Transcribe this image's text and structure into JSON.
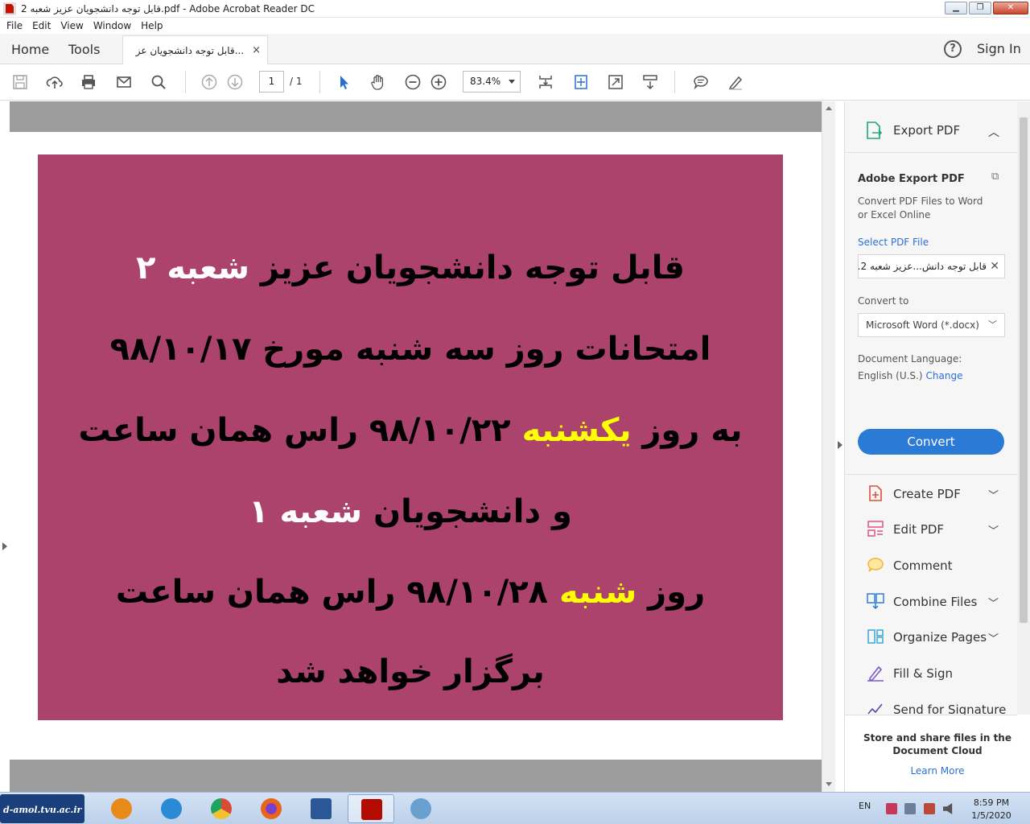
{
  "window": {
    "title": "قابل توجه دانشجویان عزیز شعبه 2.pdf - Adobe Acrobat Reader DC",
    "controls": {
      "minimize": "▁",
      "restore": "❐",
      "close": "✕"
    }
  },
  "menu": [
    "File",
    "Edit",
    "View",
    "Window",
    "Help"
  ],
  "nav": {
    "home": "Home",
    "tools": "Tools",
    "sign_in": "Sign In",
    "help": "?"
  },
  "tab": {
    "label": "قابل توجه دانشجویان عز...",
    "close": "×"
  },
  "toolbar": {
    "page_current": "1",
    "page_total": "/ 1",
    "zoom": "83.4%"
  },
  "document": {
    "background": "#ab436c",
    "lines": [
      [
        {
          "t": "قابل توجه دانشجویان عزیز ",
          "c": "black"
        },
        {
          "t": "شعبه ۲",
          "c": "white"
        }
      ],
      [
        {
          "t": "امتحانات روز سه شنبه مورخ ۹۸/۱۰/۱۷",
          "c": "black"
        }
      ],
      [
        {
          "t": "به روز ",
          "c": "black"
        },
        {
          "t": "یکشنبه",
          "c": "yellow"
        },
        {
          "t": " ۹۸/۱۰/۲۲ راس همان ساعت",
          "c": "black"
        }
      ],
      [
        {
          "t": "و دانشجویان ",
          "c": "black"
        },
        {
          "t": "شعبه ۱",
          "c": "white"
        }
      ],
      [
        {
          "t": "روز ",
          "c": "black"
        },
        {
          "t": "شنبه",
          "c": "yellow"
        },
        {
          "t": " ۹۸/۱۰/۲۸ راس همان ساعت",
          "c": "black"
        }
      ],
      [
        {
          "t": "برگزار خواهد شد",
          "c": "black"
        }
      ]
    ]
  },
  "right_pane": {
    "export_header": "Export PDF",
    "export_title": "Adobe Export PDF",
    "export_desc": "Convert PDF Files to Word or Excel Online",
    "select_link": "Select PDF File",
    "file_name": "قابل توجه دانش...عزیز شعبه 2.pdf",
    "convert_to_label": "Convert to",
    "convert_format": "Microsoft Word (*.docx)",
    "doc_lang_label": "Document Language:",
    "doc_lang_value": "English (U.S.)",
    "change_link": "Change",
    "convert_button": "Convert",
    "tools": [
      {
        "label": "Create PDF",
        "icon": "create-pdf-icon",
        "color": "#e0503a",
        "chevron": true
      },
      {
        "label": "Edit PDF",
        "icon": "edit-pdf-icon",
        "color": "#e0508a",
        "chevron": true
      },
      {
        "label": "Comment",
        "icon": "comment-icon",
        "color": "#f2b632",
        "chevron": false
      },
      {
        "label": "Combine Files",
        "icon": "combine-files-icon",
        "color": "#2a7ed6",
        "chevron": true
      },
      {
        "label": "Organize Pages",
        "icon": "organize-pages-icon",
        "color": "#36a8d6",
        "chevron": true
      },
      {
        "label": "Fill & Sign",
        "icon": "fill-sign-icon",
        "color": "#7a5cc9",
        "chevron": false
      },
      {
        "label": "Send for Signature",
        "icon": "send-signature-icon",
        "color": "#5a4aa8",
        "chevron": false
      }
    ],
    "promo_text": "Store and share files in the Document Cloud",
    "promo_link": "Learn More"
  },
  "taskbar": {
    "brand": "d-amol.tvu.ac.ir",
    "apps": [
      {
        "name": "media-player-icon",
        "color": "#e88a1a"
      },
      {
        "name": "internet-explorer-icon",
        "color": "#2a8ad6"
      },
      {
        "name": "chrome-icon",
        "color": "#d94a38"
      },
      {
        "name": "firefox-icon",
        "color": "#e8651a"
      },
      {
        "name": "word-icon",
        "color": "#2b5797"
      },
      {
        "name": "acrobat-icon",
        "color": "#b30b00"
      },
      {
        "name": "paint-icon",
        "color": "#6aa0d0"
      }
    ],
    "lang": "EN",
    "time": "8:59 PM",
    "date": "1/5/2020"
  }
}
